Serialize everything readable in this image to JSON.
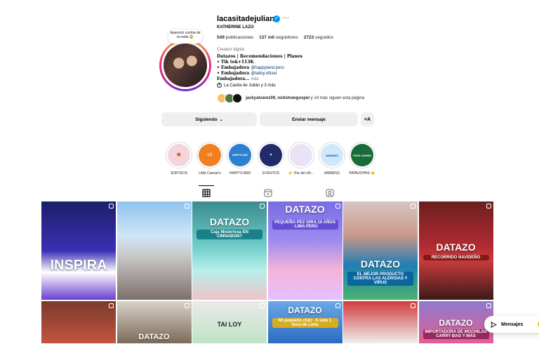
{
  "profile": {
    "username": "lacasitadejulian",
    "full_name": "KATHERINE LAZO",
    "note": "Apareció zumba de la nada 😱",
    "stats": {
      "posts": "549",
      "posts_label": "publicaciones",
      "followers": "137 mil",
      "followers_label": "seguidores",
      "following": "2723",
      "following_label": "seguidos"
    },
    "category": "Creador digital",
    "bio": {
      "line1": "Datazos | Recomendaciones | Planes",
      "line2": "• Tik tok+113K",
      "line3_prefix": "• Embajadora ",
      "line3_link": "@happyland.peru",
      "line4_prefix": "• Embajadora ",
      "line4_link": "@tailoy.oficial",
      "line5": "Embajadora...",
      "more": "más"
    },
    "facebook_link": "La Casita de Julián y 3 más",
    "followed_by_names": "jackyalvarez09, notishowgospel",
    "followed_by_suffix": "y 14 más siguen esta página"
  },
  "buttons": {
    "following": "Siguiendo",
    "message": "Enviar mensaje",
    "suggest_icon": "+A"
  },
  "highlights": [
    {
      "label": "SORTEOS",
      "color": "#f3d6dd",
      "text": "🎁"
    },
    {
      "label": "Little Caesar's",
      "color": "#f07f21",
      "text": "LC"
    },
    {
      "label": "HAPPYLAND",
      "color": "#2f7fd0",
      "text": "HAPPYLAND"
    },
    {
      "label": "EVENTOS",
      "color": "#232a6a",
      "text": "✦"
    },
    {
      "label": "👉 Día del niñ...",
      "color": "#e9e3f5",
      "text": ""
    },
    {
      "label": "AMMENS",
      "color": "#cfe8fb",
      "text": "AMMENS"
    },
    {
      "label": "PAPAJOHNS 👏",
      "color": "#1a6b3a",
      "text": "PAPA JOHNS"
    }
  ],
  "posts_row1": [
    {
      "caption": "",
      "sub": "INSPIRA"
    },
    {
      "caption": "",
      "sub": ""
    },
    {
      "caption": "DATAZO",
      "sub": "Caja Misteriosa EN CINNABON?"
    },
    {
      "caption": "DATAZO",
      "sub": "PEQUEÑO PEZ GIRA 10 AÑOS · LIMA PERÚ"
    },
    {
      "caption": "DATAZO",
      "sub": "EL MEJOR PRODUCTO CONTRA LAS ALERGIAS Y VIRUS"
    },
    {
      "caption": "DATAZO",
      "sub": "RECORRIDO NAVIDEÑO"
    }
  ],
  "posts_row2": [
    {
      "caption": "",
      "sub": ""
    },
    {
      "caption": "DATAZO",
      "sub": ""
    },
    {
      "caption": "TAI LOY",
      "sub": ""
    },
    {
      "caption": "DATAZO",
      "sub": "Mi pequeño club · A solo 1 hora de Lima"
    },
    {
      "caption": "",
      "sub": ""
    },
    {
      "caption": "DATAZO",
      "sub": "IMPORTADORA DE MOCHILAS CARRY BAG Y MÁS"
    }
  ],
  "messages_label": "Mensajes",
  "colors": {
    "verified": "#0095f6",
    "link": "#00376b",
    "button_bg": "#efefef"
  }
}
